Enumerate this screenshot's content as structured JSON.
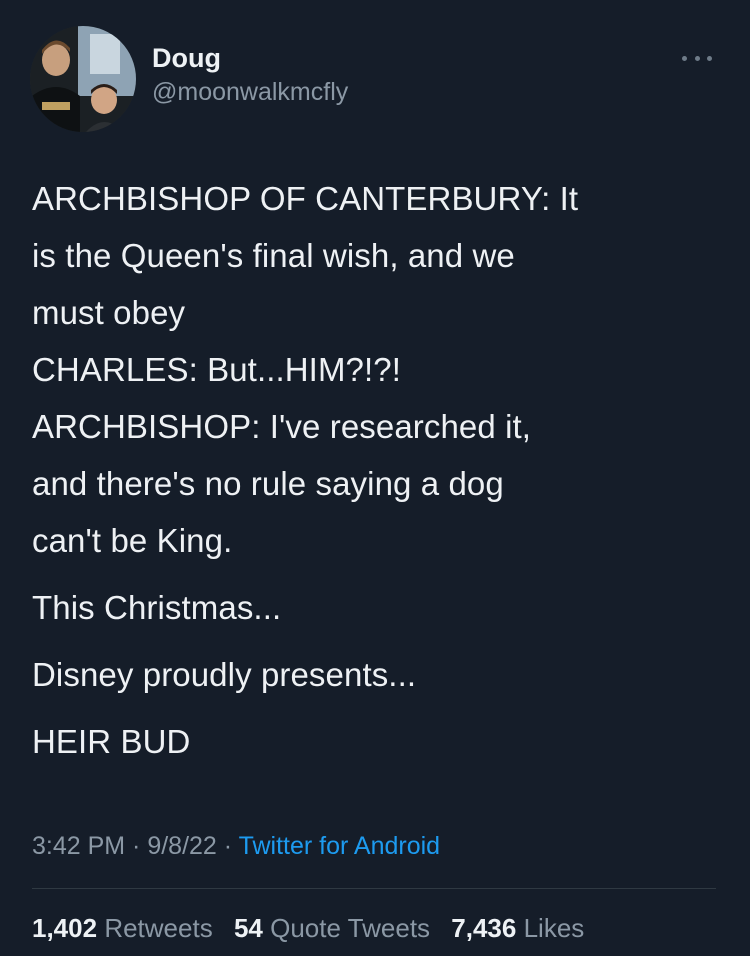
{
  "author": {
    "display_name": "Doug",
    "handle": "@moonwalkmcfly",
    "avatar_icon": "profile-photo"
  },
  "more_icon": "more-dots-icon",
  "tweet": {
    "lines": [
      "ARCHBISHOP OF CANTERBURY: It",
      "is the Queen's final wish, and we",
      "must obey",
      "CHARLES: But...HIM?!?!",
      "ARCHBISHOP: I've researched it,",
      "and there's no rule saying a dog",
      "can't be King.",
      "This Christmas...",
      "Disney proudly presents...",
      "HEIR BUD"
    ]
  },
  "meta": {
    "time": "3:42 PM",
    "date": "9/8/22",
    "source": "Twitter for Android"
  },
  "stats": {
    "retweets_count": "1,402",
    "retweets_label": "Retweets",
    "quotes_count": "54",
    "quotes_label": "Quote Tweets",
    "likes_count": "7,436",
    "likes_label": "Likes"
  },
  "colors": {
    "background": "#151d29",
    "link": "#1d9bf0",
    "muted": "#8b98a5"
  }
}
